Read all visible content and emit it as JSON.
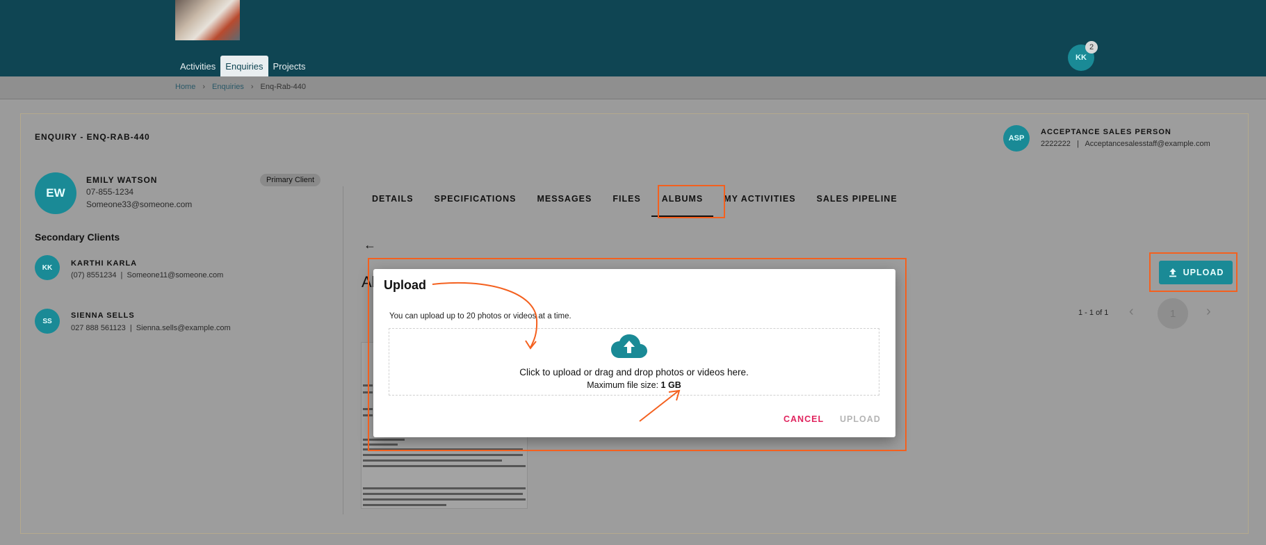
{
  "header": {
    "nav": [
      "Activities",
      "Enquiries",
      "Projects"
    ],
    "active_nav": "Enquiries",
    "user_initials": "KK",
    "notification_count": "2"
  },
  "breadcrumb": {
    "home": "Home",
    "section": "Enquiries",
    "current": "Enq-Rab-440"
  },
  "enquiry": {
    "title": "ENQUIRY - ENQ-RAB-440"
  },
  "sales_person": {
    "initials": "ASP",
    "name": "ACCEPTANCE SALES PERSON",
    "phone": "2222222",
    "email": "Acceptancesalesstaff@example.com",
    "contact_line": "2222222  |  Acceptancesalesstaff@example.com"
  },
  "client": {
    "initials": "EW",
    "name": "EMILY WATSON",
    "phone": "07-855-1234",
    "email": "Someone33@someone.com",
    "chip": "Primary Client"
  },
  "secondary": {
    "title": "Secondary Clients",
    "items": [
      {
        "initials": "KK",
        "name": "KARTHI KARLA",
        "contact": "(07) 8551234  |  Someone11@someone.com"
      },
      {
        "initials": "SS",
        "name": "SIENNA SELLS",
        "contact": "027 888 561123  |  Sienna.sells@example.com"
      }
    ]
  },
  "tabs": [
    "DETAILS",
    "SPECIFICATIONS",
    "MESSAGES",
    "FILES",
    "ALBUMS",
    "MY ACTIVITIES",
    "SALES PIPELINE"
  ],
  "active_tab": "ALBUMS",
  "albums": {
    "heading": "Al",
    "upload_label": "UPLOAD",
    "pager_text": "1 - 1 of 1",
    "page": "1"
  },
  "dialog": {
    "title": "Upload",
    "info": "You can upload up to 20 photos or videos at a time.",
    "drop_text": "Click to upload or drag and drop photos or videos here.",
    "size_label": "Maximum file size:",
    "size_value": "1 GB",
    "cancel": "CANCEL",
    "upload": "UPLOAD"
  },
  "colors": {
    "header": "#0f4553",
    "accent": "#1a8a96",
    "highlight": "#f4601e",
    "cancel": "#e0245e"
  }
}
